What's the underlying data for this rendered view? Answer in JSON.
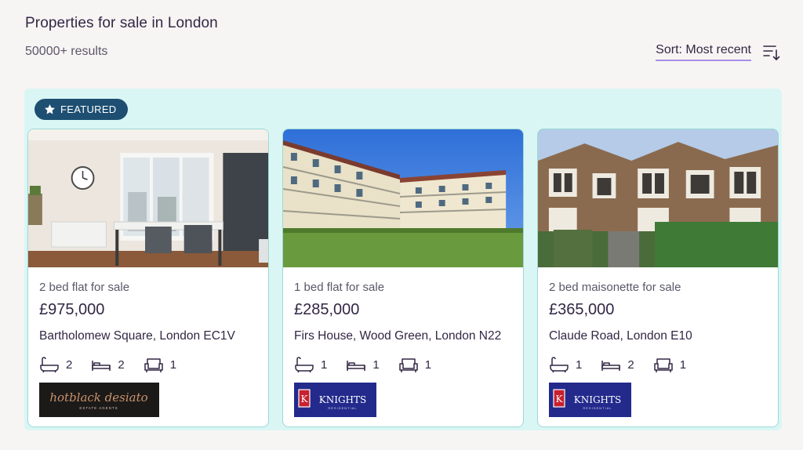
{
  "header": {
    "title": "Properties for sale in London",
    "results": "50000+ results",
    "sort_label": "Sort: Most recent"
  },
  "featured": {
    "badge_label": "FEATURED"
  },
  "listings": [
    {
      "type": "2 bed flat for sale",
      "price": "£975,000",
      "address": "Bartholomew Square, London EC1V",
      "baths": "2",
      "beds": "2",
      "receptions": "1",
      "agent_logo_text": "hotblack desiato",
      "agent_logo_subtext": "ESTATE AGENTS"
    },
    {
      "type": "1 bed flat for sale",
      "price": "£285,000",
      "address": "Firs House, Wood Green, London N22",
      "baths": "1",
      "beds": "1",
      "receptions": "1",
      "agent_logo_text": "KNIGHTS",
      "agent_logo_subtext": "RESIDENTIAL"
    },
    {
      "type": "2 bed maisonette for sale",
      "price": "£365,000",
      "address": "Claude Road, London E10",
      "baths": "1",
      "beds": "2",
      "receptions": "1",
      "agent_logo_text": "KNIGHTS",
      "agent_logo_subtext": "RESIDENTIAL"
    }
  ],
  "colors": {
    "background": "#f7f5f4",
    "featured_panel": "#d9f6f4",
    "badge": "#1e4f72",
    "sort_underline": "#a68ee6",
    "text_primary": "#322744"
  }
}
